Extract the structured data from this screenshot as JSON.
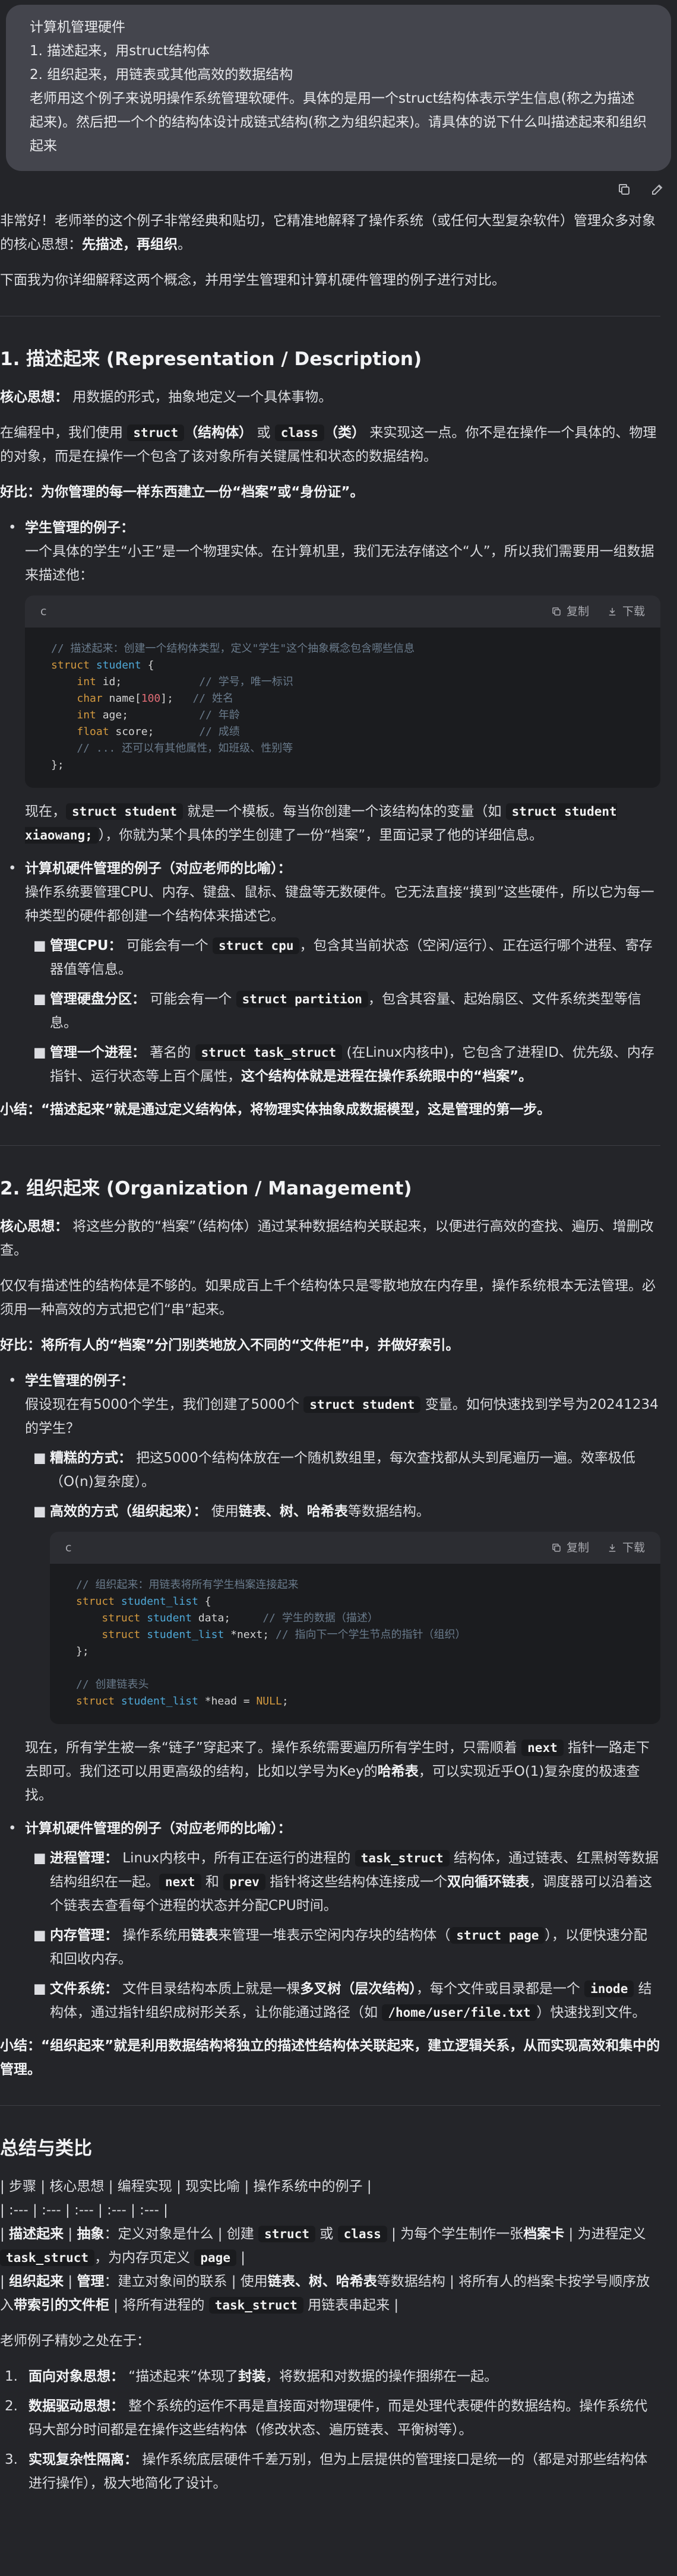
{
  "user_message": {
    "lines": [
      "计算机管理硬件",
      "1. 描述起来，用struct结构体",
      "2. 组织起来，用链表或其他高效的数据结构",
      "老师用这个例子来说明操作系统管理软硬件。具体的是用一个struct结构体表示学生信息(称之为描述起来)。然后把一个个的结构体设计成链式结构(称之为组织起来)。请具体的说下什么叫描述起来和组织起来"
    ]
  },
  "actions": {
    "copy_icon": "copy-icon",
    "edit_icon": "edit-icon"
  },
  "intro": {
    "p1_a": "非常好！老师举的这个例子非常经典和贴切，它精准地解释了操作系统（或任何大型复杂软件）管理众多对象的核心思想：",
    "p1_b": "先描述，再组织",
    "p1_c": "。",
    "p2": "下面我为你详细解释这两个概念，并用学生管理和计算机硬件管理的例子进行对比。"
  },
  "code_toolbar": {
    "lang": "c",
    "copy": "复制",
    "download": "下载"
  },
  "section1": {
    "title": "1. 描述起来 (Representation / Description)",
    "core_label": "核心思想：",
    "core_text": " 用数据的形式，抽象地定义一个具体事物。",
    "p_a": "在编程中，我们使用 ",
    "code_struct": "struct",
    "p_b": "（结构体）",
    "p_c": " 或 ",
    "code_class": "class",
    "p_d": "（类）",
    "p_e": " 来实现这一点。你不是在操作一个具体的、物理的对象，而是在操作一个包含了该对象所有关键属性和状态的数据结构。",
    "analogy": "好比：为你管理的每一样东西建立一份“档案”或“身份证”。",
    "student_title": "学生管理的例子：",
    "student_text": "一个具体的学生“小王”是一个物理实体。在计算机里，我们无法存储这个“人”，所以我们需要用一组数据来描述他：",
    "code_lines": [
      "// 描述起来：创建一个结构体类型，定义\"学生\"这个抽象概念包含哪些信息",
      "struct student {",
      "    int id;            // 学号，唯一标识",
      "    char name[100];   // 姓名",
      "    int age;           // 年龄",
      "    float score;       // 成绩",
      "    // ... 还可以有其他属性，如班级、性别等",
      "};"
    ],
    "after_a": "现在，",
    "after_code1": "struct student",
    "after_b": " 就是一个模板。每当你创建一个该结构体的变量（如 ",
    "after_code2": "struct student xiaowang;",
    "after_c": "），你就为某个具体的学生创建了一份“档案”，里面记录了他的详细信息。",
    "hw_title": "计算机硬件管理的例子（对应老师的比喻）：",
    "hw_text": "操作系统要管理CPU、内存、键盘、鼠标、键盘等无数硬件。它无法直接“摸到”这些硬件，所以它为每一种类型的硬件都创建一个结构体来描述它。",
    "hw_items": [
      {
        "label": "管理CPU：",
        "a": " 可能会有一个 ",
        "code": "struct cpu",
        "b": "，包含其当前状态（空闲/运行）、正在运行哪个进程、寄存器值等信息。",
        "c": ""
      },
      {
        "label": "管理硬盘分区：",
        "a": " 可能会有一个 ",
        "code": "struct partition",
        "b": "，包含其容量、起始扇区、文件系统类型等信息。",
        "c": ""
      },
      {
        "label": "管理一个进程：",
        "a": " 著名的 ",
        "code": "struct task_struct",
        "b": " (在Linux内核中)，它包含了进程ID、优先级、内存指针、运行状态等上百个属性，",
        "c": "这个结构体就是进程在操作系统眼中的“档案”。"
      }
    ],
    "summary": "小结：“描述起来”就是通过定义结构体，将物理实体抽象成数据模型，这是管理的第一步。"
  },
  "section2": {
    "title": "2. 组织起来 (Organization / Management)",
    "core_label": "核心思想：",
    "core_text": " 将这些分散的“档案”（结构体）通过某种数据结构关联起来，以便进行高效的查找、遍历、增删改查。",
    "p1": "仅仅有描述性的结构体是不够的。如果成百上千个结构体只是零散地放在内存里，操作系统根本无法管理。必须用一种高效的方式把它们“串”起来。",
    "analogy": "好比：将所有人的“档案”分门别类地放入不同的“文件柜”中，并做好索引。",
    "student_title": "学生管理的例子：",
    "student_a": "假设现在有5000个学生，我们创建了5000个 ",
    "student_code": "struct student",
    "student_b": " 变量。如何快速找到学号为20241234的学生？",
    "naive_label": "糟糕的方式：",
    "naive_text": " 把这5000个结构体放在一个随机数组里，每次查找都从头到尾遍历一遍。效率极低（O(n)复杂度）。",
    "eff_label": "高效的方式（组织起来）：",
    "eff_a": " 使用",
    "eff_b": "链表、树、哈希表",
    "eff_c": "等数据结构。",
    "code_lines": [
      "// 组织起来：用链表将所有学生档案连接起来",
      "struct student_list {",
      "    struct student data;     // 学生的数据（描述）",
      "    struct student_list *next; // 指向下一个学生节点的指针（组织）",
      "};",
      "",
      "// 创建链表头",
      "struct student_list *head = NULL;"
    ],
    "after_a": "现在，所有学生被一条“链子”穿起来了。操作系统需要遍历所有学生时，只需顺着 ",
    "after_code": "next",
    "after_b": " 指针一路走下去即可。我们还可以用更高级的结构，比如以学号为Key的",
    "after_c": "哈希表",
    "after_d": "，可以实现近乎O(1)复杂度的极速查找。",
    "hw_title": "计算机硬件管理的例子（对应老师的比喻）：",
    "hw_items": [
      {
        "label": "进程管理：",
        "text": " Linux内核中，所有正在运行的进程的 ",
        "code": "task_struct",
        "text2": " 结构体，通过链表、红黑树等数据结构组织在一起。",
        "code2": "next",
        "text3": " 和 ",
        "code3": "prev",
        "text4": " 指针将这些结构体连接成一个",
        "bold": "双向循环链表",
        "text5": "，调度器可以沿着这个链表去查看每个进程的状态并分配CPU时间。"
      },
      {
        "label": "内存管理：",
        "text": " 操作系统用",
        "bold": "链表",
        "text2": "来管理一堆表示空闲内存块的结构体（",
        "code": "struct page",
        "text3": "），以便快速分配和回收内存。"
      },
      {
        "label": "文件系统：",
        "text": " 文件目录结构本质上就是一棵",
        "bold": "多叉树（层次结构）",
        "text2": "，每个文件或目录都是一个 ",
        "code": "inode",
        "text3": " 结构体，通过指针组织成树形关系，让你能通过路径（如 ",
        "code2": "/home/user/file.txt",
        "text4": "）快速找到文件。"
      }
    ],
    "summary": "小结：“组织起来”就是利用数据结构将独立的描述性结构体关联起来，建立逻辑关系，从而实现高效和集中的管理。"
  },
  "section3": {
    "title": "总结与类比",
    "table_lines": [
      "| 步骤 | 核心思想 | 编程实现 | 现实比喻 | 操作系统中的例子 |",
      "| :--- | :--- | :--- | :--- | :--- |"
    ],
    "row1": {
      "step": "描述起来",
      "a": " | ",
      "b": "抽象",
      "c": "：定义对象是什么 | 创建 ",
      "code1": "struct",
      "d": " 或 ",
      "code2": "class",
      "e": " | 为每个学生制作一张",
      "f": "档案卡",
      "g": " | 为进程定义 ",
      "code3": "task_struct",
      "h": "，为内存页定义 ",
      "code4": "page",
      "i": " |"
    },
    "row2": {
      "step": "组织起来",
      "a": " | ",
      "b": "管理",
      "c": "：建立对象间的联系 | 使用",
      "d": "链表、树、哈希表",
      "e": "等数据结构 | 将所有人的档案卡按学号顺序放入",
      "f": "带索引的文件柜",
      "g": " | 将所有进程的 ",
      "code1": "task_struct",
      "h": " 用链表串起来 |"
    },
    "praise": "老师例子精妙之处在于：",
    "points": [
      {
        "num": "1.",
        "label": "面向对象思想：",
        "text": " “描述起来”体现了",
        "bold": "封装",
        "text2": "，将数据和对数据的操作捆绑在一起。"
      },
      {
        "num": "2.",
        "label": "数据驱动思想：",
        "text": " 整个系统的运作不再是直接面对物理硬件，而是处理代表硬件的数据结构。操作系统代码大部分时间都是在操作这些结构体（修改状态、遍历链表、平衡树等）。",
        "bold": "",
        "text2": ""
      },
      {
        "num": "3.",
        "label": "实现复杂性隔离：",
        "text": " 操作系统底层硬件千差万别，但为上层提供的管理接口是统一的（都是对那些结构体进行操作），极大地简化了设计。",
        "bold": "",
        "text2": ""
      }
    ]
  }
}
